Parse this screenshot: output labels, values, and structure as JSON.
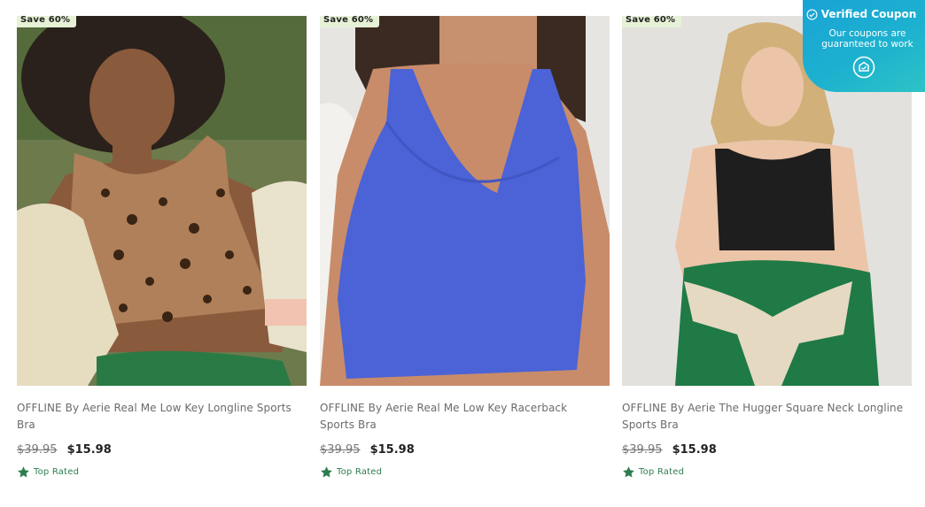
{
  "products": [
    {
      "badge": "Save 60%",
      "title": "OFFLINE By Aerie Real Me Low Key Longline Sports Bra",
      "old_price": "$39.95",
      "price": "$15.98",
      "rating_label": "Top Rated"
    },
    {
      "badge": "Save 60%",
      "title": "OFFLINE By Aerie Real Me Low Key Racerback Sports Bra",
      "old_price": "$39.95",
      "price": "$15.98",
      "rating_label": "Top Rated"
    },
    {
      "badge": "Save 60%",
      "title": "OFFLINE By Aerie The Hugger Square Neck Longline Sports Bra",
      "old_price": "$39.95",
      "price": "$15.98",
      "rating_label": "Top Rated"
    }
  ],
  "coupon": {
    "heading": "Verified Coupon",
    "subtext": "Our coupons are guaranteed to work"
  },
  "colors": {
    "badge_bg": "#e6f1d6",
    "rated_green": "#2e7d4f",
    "coupon_blue": "#1aa3d6"
  },
  "icons": [
    "check-circle-icon",
    "star-icon",
    "coupon-logo-icon"
  ]
}
